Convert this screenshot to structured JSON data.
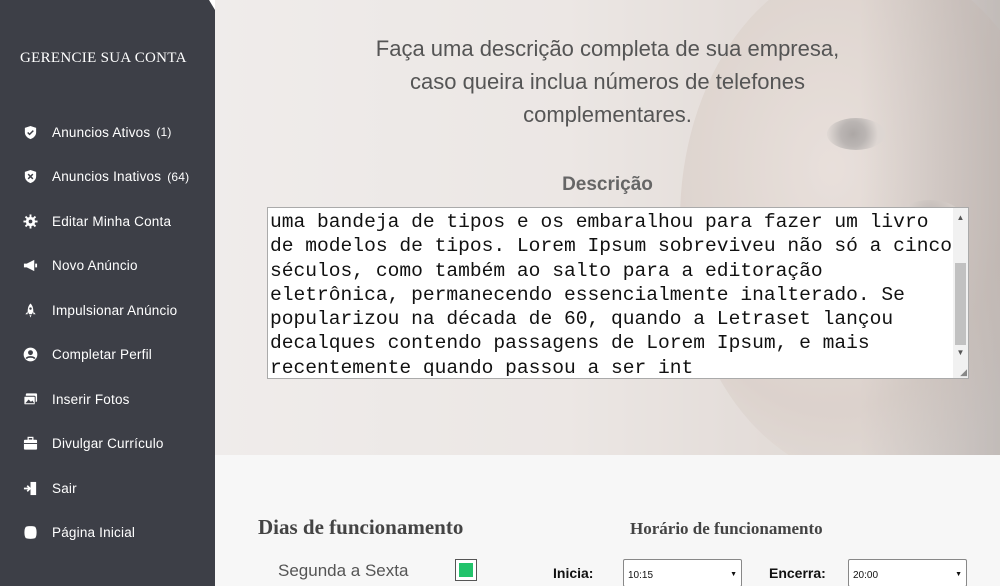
{
  "sidebar": {
    "title": "GERENCIE SUA CONTA",
    "items": [
      {
        "label": "Anuncios Ativos",
        "count": "(1)",
        "icon": "shield-check-icon"
      },
      {
        "label": "Anuncios Inativos",
        "count": "(64)",
        "icon": "shield-x-icon"
      },
      {
        "label": "Editar Minha Conta",
        "count": "",
        "icon": "gear-icon"
      },
      {
        "label": "Novo Anúncio",
        "count": "",
        "icon": "megaphone-icon"
      },
      {
        "label": "Impulsionar Anúncio",
        "count": "",
        "icon": "rocket-icon"
      },
      {
        "label": "Completar Perfil",
        "count": "",
        "icon": "user-circle-icon"
      },
      {
        "label": "Inserir Fotos",
        "count": "",
        "icon": "images-icon"
      },
      {
        "label": "Divulgar Currículo",
        "count": "",
        "icon": "briefcase-icon"
      },
      {
        "label": "Sair",
        "count": "",
        "icon": "sign-out-icon"
      },
      {
        "label": "Página Inicial",
        "count": "",
        "icon": "home-icon"
      }
    ]
  },
  "hero": {
    "instruction_line1": "Faça uma descrição completa de sua empresa,",
    "instruction_line2": "caso queira inclua números de telefones",
    "instruction_line3": "complementares.",
    "description_label": "Descrição",
    "description_text": "uma bandeja de tipos e os embaralhou para fazer um livro de modelos de tipos. Lorem Ipsum sobreviveu não só a cinco séculos, como também ao salto para a editoração eletrônica, permanecendo essencialmente inalterado. Se popularizou na década de 60, quando a Letraset lançou decalques contendo passagens de Lorem Ipsum, e mais recentemente quando passou a ser int"
  },
  "schedule": {
    "days_title": "Dias de funcionamento",
    "hours_title": "Horário de funcionamento",
    "day_label": "Segunda a Sexta",
    "day_checked": true,
    "start_label": "Inicia:",
    "start_value": "10:15",
    "end_label": "Encerra:",
    "end_value": "20:00",
    "check_color": "#22c36b"
  }
}
